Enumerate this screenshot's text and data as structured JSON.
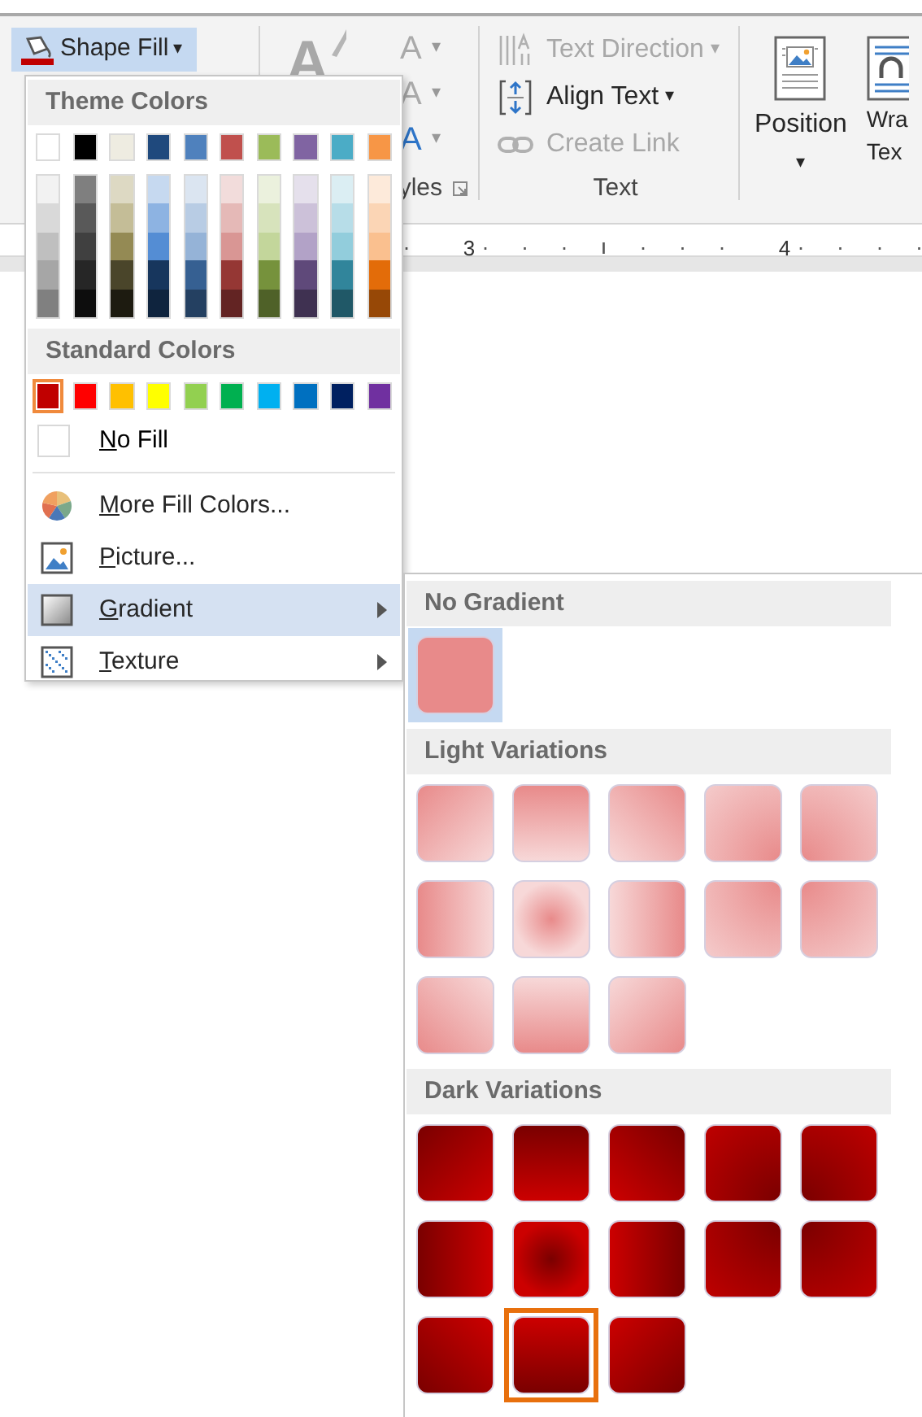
{
  "ribbon": {
    "shape_fill": {
      "label": "Shape Fill",
      "caret": "▾"
    },
    "wordart_group": {
      "big_glyph": "A",
      "items": [
        {
          "glyph": "A",
          "caret": "▾",
          "disabled": true
        },
        {
          "glyph": "A",
          "caret": "▾",
          "disabled": true
        },
        {
          "glyph": "A",
          "caret": "▾",
          "disabled": false
        }
      ],
      "label": "yles"
    },
    "text_group": {
      "items": [
        {
          "kind": "direction",
          "label": "Text Direction",
          "caret": "▾",
          "disabled": true
        },
        {
          "kind": "align",
          "label": "Align Text",
          "caret": "▾",
          "disabled": false
        },
        {
          "kind": "link",
          "label": "Create Link",
          "disabled": true
        }
      ],
      "label": "Text"
    },
    "arrange_group": {
      "position": {
        "label": "Position",
        "caret": "▾"
      },
      "wrap": {
        "lines": [
          "Wra",
          "Tex"
        ]
      }
    }
  },
  "ruler": {
    "numbers": [
      "3",
      "4"
    ]
  },
  "shape_fill_menu": {
    "theme_header": "Theme Colors",
    "theme_colors": [
      {
        "color": "#ffffff",
        "shades": [
          {
            "color": "#f2f2f2"
          },
          {
            "color": "#d9d9d9"
          },
          {
            "color": "#bfbfbf"
          },
          {
            "color": "#a6a6a6"
          },
          {
            "color": "#808080"
          }
        ]
      },
      {
        "color": "#000000",
        "shades": [
          {
            "color": "#7f7f7f"
          },
          {
            "color": "#595959"
          },
          {
            "color": "#404040"
          },
          {
            "color": "#262626"
          },
          {
            "color": "#0d0d0d"
          }
        ]
      },
      {
        "color": "#eeece1",
        "shades": [
          {
            "color": "#ddd9c3"
          },
          {
            "color": "#c4bd97"
          },
          {
            "color": "#948a54"
          },
          {
            "color": "#4a452a"
          },
          {
            "color": "#1d1b10"
          }
        ]
      },
      {
        "color": "#1f497d",
        "shades": [
          {
            "color": "#c6d9f0"
          },
          {
            "color": "#8db3e2"
          },
          {
            "color": "#548dd4"
          },
          {
            "color": "#17365d"
          },
          {
            "color": "#0f243e"
          }
        ]
      },
      {
        "color": "#4f81bd",
        "shades": [
          {
            "color": "#dbe5f1"
          },
          {
            "color": "#b8cce4"
          },
          {
            "color": "#95b3d7"
          },
          {
            "color": "#366092"
          },
          {
            "color": "#244061"
          }
        ]
      },
      {
        "color": "#c0504d",
        "shades": [
          {
            "color": "#f2dcdb"
          },
          {
            "color": "#e5b9b7"
          },
          {
            "color": "#d99694"
          },
          {
            "color": "#953734"
          },
          {
            "color": "#632423"
          }
        ]
      },
      {
        "color": "#9bbb59",
        "shades": [
          {
            "color": "#ebf1dd"
          },
          {
            "color": "#d7e3bc"
          },
          {
            "color": "#c3d69b"
          },
          {
            "color": "#76923c"
          },
          {
            "color": "#4f6128"
          }
        ]
      },
      {
        "color": "#8064a2",
        "shades": [
          {
            "color": "#e5e0ec"
          },
          {
            "color": "#ccc1d9"
          },
          {
            "color": "#b2a2c7"
          },
          {
            "color": "#5f497a"
          },
          {
            "color": "#3f3151"
          }
        ]
      },
      {
        "color": "#4bacc6",
        "shades": [
          {
            "color": "#dbeef3"
          },
          {
            "color": "#b7dde8"
          },
          {
            "color": "#92cddc"
          },
          {
            "color": "#31859b"
          },
          {
            "color": "#205867"
          }
        ]
      },
      {
        "color": "#f79646",
        "shades": [
          {
            "color": "#fdeada"
          },
          {
            "color": "#fbd5b5"
          },
          {
            "color": "#fac08f"
          },
          {
            "color": "#e36c09"
          },
          {
            "color": "#974806"
          }
        ]
      }
    ],
    "standard_header": "Standard Colors",
    "standard_colors": [
      {
        "color": "#c00000",
        "selected": true
      },
      {
        "color": "#ff0000",
        "selected": false
      },
      {
        "color": "#ffc000",
        "selected": false
      },
      {
        "color": "#ffff00",
        "selected": false
      },
      {
        "color": "#92d050",
        "selected": false
      },
      {
        "color": "#00b050",
        "selected": false
      },
      {
        "color": "#00b0f0",
        "selected": false
      },
      {
        "color": "#0070c0",
        "selected": false
      },
      {
        "color": "#002060",
        "selected": false
      },
      {
        "color": "#7030a0",
        "selected": false
      }
    ],
    "no_fill": "No Fill",
    "items": [
      {
        "kind": "colors",
        "label": "More Fill Colors...",
        "submenu": false,
        "highlighted": false
      },
      {
        "kind": "picture",
        "label": "Picture...",
        "submenu": false,
        "highlighted": false
      },
      {
        "kind": "gradient",
        "label": "Gradient",
        "submenu": true,
        "highlighted": true
      },
      {
        "kind": "texture",
        "label": "Texture",
        "submenu": true,
        "highlighted": false
      }
    ]
  },
  "gradient_menu": {
    "sections": [
      {
        "title": "No Gradient",
        "kind": "solid",
        "swatches": [
          {
            "kind": "solid",
            "current": true,
            "selected": false
          }
        ]
      },
      {
        "title": "Light Variations",
        "kind": "light",
        "swatches": [
          {
            "kind": "top-left",
            "current": false,
            "selected": false
          },
          {
            "kind": "top",
            "current": false,
            "selected": false
          },
          {
            "kind": "top-right",
            "current": false,
            "selected": false
          },
          {
            "kind": "corner-bottom-right",
            "current": false,
            "selected": false
          },
          {
            "kind": "corner-bottom-left",
            "current": false,
            "selected": false
          },
          {
            "kind": "left",
            "current": false,
            "selected": false
          },
          {
            "kind": "center",
            "current": false,
            "selected": false
          },
          {
            "kind": "right",
            "current": false,
            "selected": false
          },
          {
            "kind": "corner-top-right",
            "current": false,
            "selected": false
          },
          {
            "kind": "corner-top-left",
            "current": false,
            "selected": false
          },
          {
            "kind": "bottom-left",
            "current": false,
            "selected": false
          },
          {
            "kind": "bottom",
            "current": false,
            "selected": false
          },
          {
            "kind": "bottom-right",
            "current": false,
            "selected": false
          }
        ]
      },
      {
        "title": "Dark Variations",
        "kind": "dark",
        "swatches": [
          {
            "kind": "top-left",
            "current": false,
            "selected": false
          },
          {
            "kind": "top",
            "current": false,
            "selected": false
          },
          {
            "kind": "top-right",
            "current": false,
            "selected": false
          },
          {
            "kind": "corner-bottom-right",
            "current": false,
            "selected": false
          },
          {
            "kind": "corner-bottom-left",
            "current": false,
            "selected": false
          },
          {
            "kind": "left",
            "current": false,
            "selected": false
          },
          {
            "kind": "center",
            "current": false,
            "selected": false
          },
          {
            "kind": "right",
            "current": false,
            "selected": false
          },
          {
            "kind": "corner-top-right",
            "current": false,
            "selected": false
          },
          {
            "kind": "corner-top-left",
            "current": false,
            "selected": false
          },
          {
            "kind": "bottom-left",
            "current": false,
            "selected": false
          },
          {
            "kind": "bottom",
            "current": false,
            "selected": true
          },
          {
            "kind": "bottom-right",
            "current": false,
            "selected": false
          }
        ]
      }
    ]
  }
}
